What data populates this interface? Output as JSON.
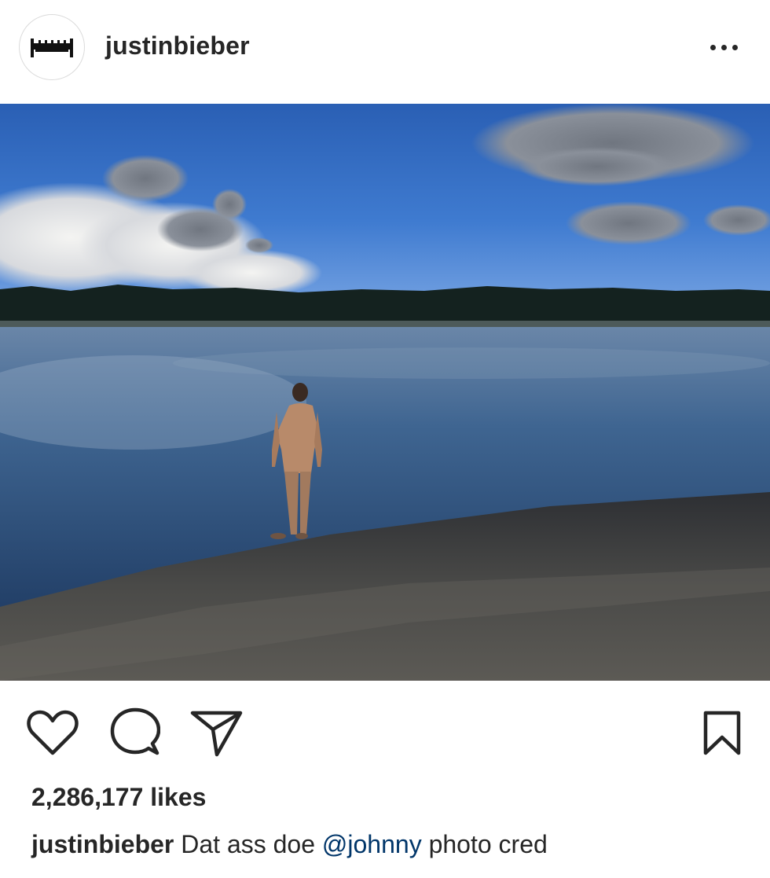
{
  "post": {
    "username": "justinbieber",
    "more_icon": "more-options-icon"
  },
  "photo": {
    "subject": "person standing at lake shore"
  },
  "actions": {
    "icons": [
      "heart-icon",
      "comment-icon",
      "share-icon",
      "bookmark-icon"
    ]
  },
  "likes": "2,286,177 likes",
  "caption": {
    "username": "justinbieber",
    "text_before": "Dat ass doe",
    "mention": "@johnny",
    "text_after": "photo cred"
  },
  "colors": {
    "text": "#262626",
    "mention": "#003569",
    "border": "#dbdbdb"
  }
}
